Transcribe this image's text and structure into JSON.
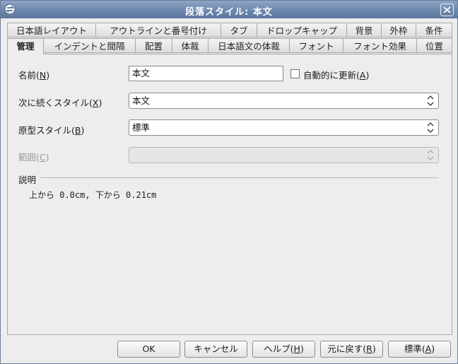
{
  "window": {
    "title": "段落スタイル: 本文"
  },
  "tabs_row1": [
    "日本語レイアウト",
    "アウトラインと番号付け",
    "タブ",
    "ドロップキャップ",
    "背景",
    "外枠",
    "条件"
  ],
  "tabs_row2": [
    "管理",
    "インデントと間隔",
    "配置",
    "体裁",
    "日本語文の体裁",
    "フォント",
    "フォント効果",
    "位置"
  ],
  "active_tab": "管理",
  "form": {
    "name_label": "名前(",
    "name_key": "N",
    "name_value": "本文",
    "autoupdate_label": "自動的に更新(",
    "autoupdate_key": "A",
    "next_label": "次に続くスタイル(",
    "next_key": "X",
    "next_value": "本文",
    "parent_label": "原型スタイル(",
    "parent_key": "B",
    "parent_value": "標準",
    "category_label": "範囲(",
    "category_key": "C",
    "category_value": "",
    "close_paren": ")"
  },
  "description": {
    "heading": "説明",
    "text": "上から 0.0cm, 下から 0.21cm"
  },
  "buttons": {
    "ok": "OK",
    "cancel": "キャンセル",
    "help_label": "ヘルプ(",
    "help_key": "H",
    "reset_label": "元に戻す(",
    "reset_key": "R",
    "standard_label": "標準(",
    "standard_key": "A",
    "close_paren": ")"
  },
  "colors": {
    "titlebar": "#7089ae",
    "background": "#ededed"
  }
}
